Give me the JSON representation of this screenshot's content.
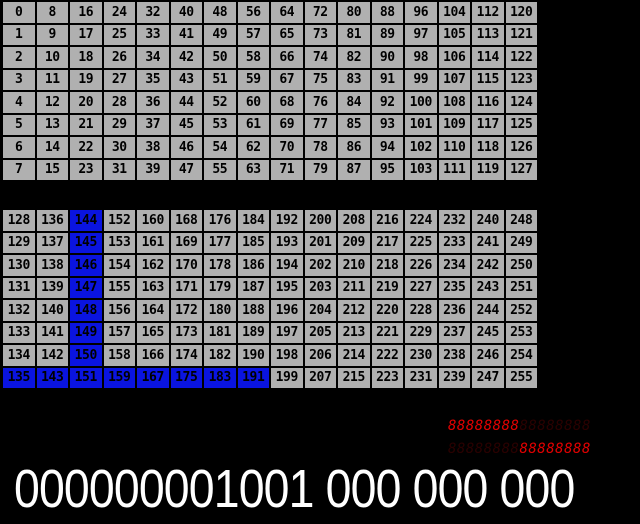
{
  "top_block": {
    "cells": [
      "0",
      "8",
      "16",
      "24",
      "32",
      "40",
      "48",
      "56",
      "64",
      "72",
      "80",
      "88",
      "96",
      "104",
      "112",
      "120",
      "1",
      "9",
      "17",
      "25",
      "33",
      "41",
      "49",
      "57",
      "65",
      "73",
      "81",
      "89",
      "97",
      "105",
      "113",
      "121",
      "2",
      "10",
      "18",
      "26",
      "34",
      "42",
      "50",
      "58",
      "66",
      "74",
      "82",
      "90",
      "98",
      "106",
      "114",
      "122",
      "3",
      "11",
      "19",
      "27",
      "35",
      "43",
      "51",
      "59",
      "67",
      "75",
      "83",
      "91",
      "99",
      "107",
      "115",
      "123",
      "4",
      "12",
      "20",
      "28",
      "36",
      "44",
      "52",
      "60",
      "68",
      "76",
      "84",
      "92",
      "100",
      "108",
      "116",
      "124",
      "5",
      "13",
      "21",
      "29",
      "37",
      "45",
      "53",
      "61",
      "69",
      "77",
      "85",
      "93",
      "101",
      "109",
      "117",
      "125",
      "6",
      "14",
      "22",
      "30",
      "38",
      "46",
      "54",
      "62",
      "70",
      "78",
      "86",
      "94",
      "102",
      "110",
      "118",
      "126",
      "7",
      "15",
      "23",
      "31",
      "39",
      "47",
      "55",
      "63",
      "71",
      "79",
      "87",
      "95",
      "103",
      "111",
      "119",
      "127"
    ],
    "selected": []
  },
  "bottom_block": {
    "cells": [
      "128",
      "136",
      "144",
      "152",
      "160",
      "168",
      "176",
      "184",
      "192",
      "200",
      "208",
      "216",
      "224",
      "232",
      "240",
      "248",
      "129",
      "137",
      "145",
      "153",
      "161",
      "169",
      "177",
      "185",
      "193",
      "201",
      "209",
      "217",
      "225",
      "233",
      "241",
      "249",
      "130",
      "138",
      "146",
      "154",
      "162",
      "170",
      "178",
      "186",
      "194",
      "202",
      "210",
      "218",
      "226",
      "234",
      "242",
      "250",
      "131",
      "139",
      "147",
      "155",
      "163",
      "171",
      "179",
      "187",
      "195",
      "203",
      "211",
      "219",
      "227",
      "235",
      "243",
      "251",
      "132",
      "140",
      "148",
      "156",
      "164",
      "172",
      "180",
      "188",
      "196",
      "204",
      "212",
      "220",
      "228",
      "236",
      "244",
      "252",
      "133",
      "141",
      "149",
      "157",
      "165",
      "173",
      "181",
      "189",
      "197",
      "205",
      "213",
      "221",
      "229",
      "237",
      "245",
      "253",
      "134",
      "142",
      "150",
      "158",
      "166",
      "174",
      "182",
      "190",
      "198",
      "206",
      "214",
      "222",
      "230",
      "238",
      "246",
      "254",
      "135",
      "143",
      "151",
      "159",
      "167",
      "175",
      "183",
      "191",
      "199",
      "207",
      "215",
      "223",
      "231",
      "239",
      "247",
      "255"
    ],
    "selected": [
      "144",
      "145",
      "146",
      "147",
      "148",
      "149",
      "150",
      "135",
      "143",
      "151",
      "159",
      "167",
      "175",
      "183",
      "191"
    ]
  },
  "led_display": {
    "row1_lit": "88888888",
    "row1_unlit": "88888888",
    "row2_unlit": "88888888",
    "row2_lit": "88888888"
  },
  "readout": "000000001001 000 000 000",
  "colors": {
    "cell_bg": "#b0b0b0",
    "selected_bg": "#0a14e0",
    "led_on": "#e10000",
    "led_off": "#2a0000",
    "background": "#000000",
    "readout_text": "#ffffff"
  }
}
